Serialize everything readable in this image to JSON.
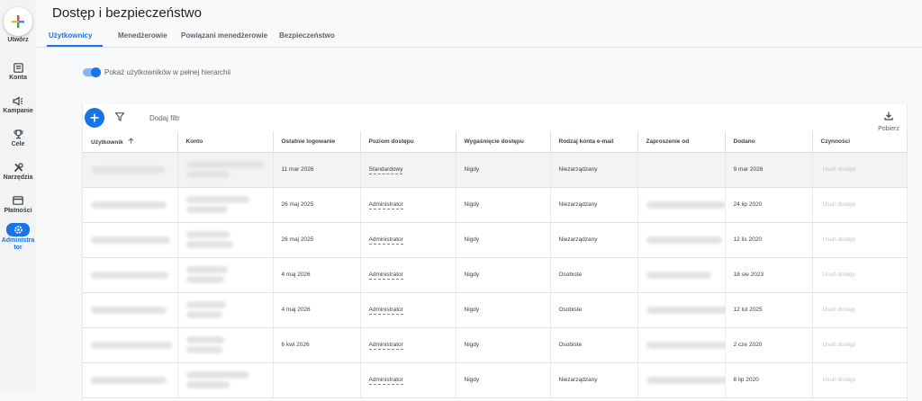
{
  "nav": {
    "create_label": "Utwórz",
    "items": [
      {
        "label": "Konta",
        "icon": "accounts-icon"
      },
      {
        "label": "Kampanie",
        "icon": "campaigns-icon"
      },
      {
        "label": "Cele",
        "icon": "goals-icon"
      },
      {
        "label": "Narzędzia",
        "icon": "tools-icon"
      },
      {
        "label": "Płatności",
        "icon": "billing-icon"
      },
      {
        "label": "Administra tor",
        "icon": "admin-gear-icon",
        "active": true
      }
    ]
  },
  "header": {
    "title": "Dostęp i bezpieczeństwo"
  },
  "tabs": [
    {
      "label": "Użytkownicy",
      "active": true
    },
    {
      "label": "Menedżerowie"
    },
    {
      "label": "Powiązani menedżerowie"
    },
    {
      "label": "Bezpieczeństwo"
    }
  ],
  "toggle": {
    "label": "Pokaż użytkowników w pełnej hierarchii",
    "on": true
  },
  "toolbar": {
    "add_filter": "Dodaj filtr",
    "download_label": "Pobierz"
  },
  "table": {
    "columns": [
      "Użytkownik",
      "Konto",
      "Ostatnie logowanie",
      "Poziom dostępu",
      "Wygaśnięcie dostępu",
      "Rodzaj konta e-mail",
      "Zaproszenie od",
      "Dodano",
      "Czynności"
    ],
    "rows": [
      {
        "last_login": "11 mar 2026",
        "access": "Standardowy",
        "expiry": "Nigdy",
        "email_type": "Niezarządzany",
        "added": "9 mar 2026",
        "action": "Usuń dostęp"
      },
      {
        "last_login": "26 maj 2025",
        "access": "Administrator",
        "expiry": "Nigdy",
        "email_type": "Niezarządzany",
        "added": "24 lip 2020",
        "action": "Usuń dostęp"
      },
      {
        "last_login": "26 maj 2025",
        "access": "Administrator",
        "expiry": "Nigdy",
        "email_type": "Niezarządzany",
        "added": "12 lis 2020",
        "action": "Usuń dostęp"
      },
      {
        "last_login": "4 maj 2026",
        "access": "Administrator",
        "expiry": "Nigdy",
        "email_type": "Osobiste",
        "added": "18 sie 2023",
        "action": "Usuń dostęp"
      },
      {
        "last_login": "4 maj 2026",
        "access": "Administrator",
        "expiry": "Nigdy",
        "email_type": "Osobiste",
        "added": "12 lut 2025",
        "action": "Usuń dostęp"
      },
      {
        "last_login": "6 kwi 2026",
        "access": "Administrator",
        "expiry": "Nigdy",
        "email_type": "Osobiste",
        "added": "2 cze 2020",
        "action": "Usuń dostęp"
      },
      {
        "last_login": "",
        "access": "Administrator",
        "expiry": "Nigdy",
        "email_type": "Niezarządzany",
        "added": "8 lip 2020",
        "action": "Usuń dostęp"
      }
    ]
  },
  "colors": {
    "accent": "#1a73e8"
  }
}
